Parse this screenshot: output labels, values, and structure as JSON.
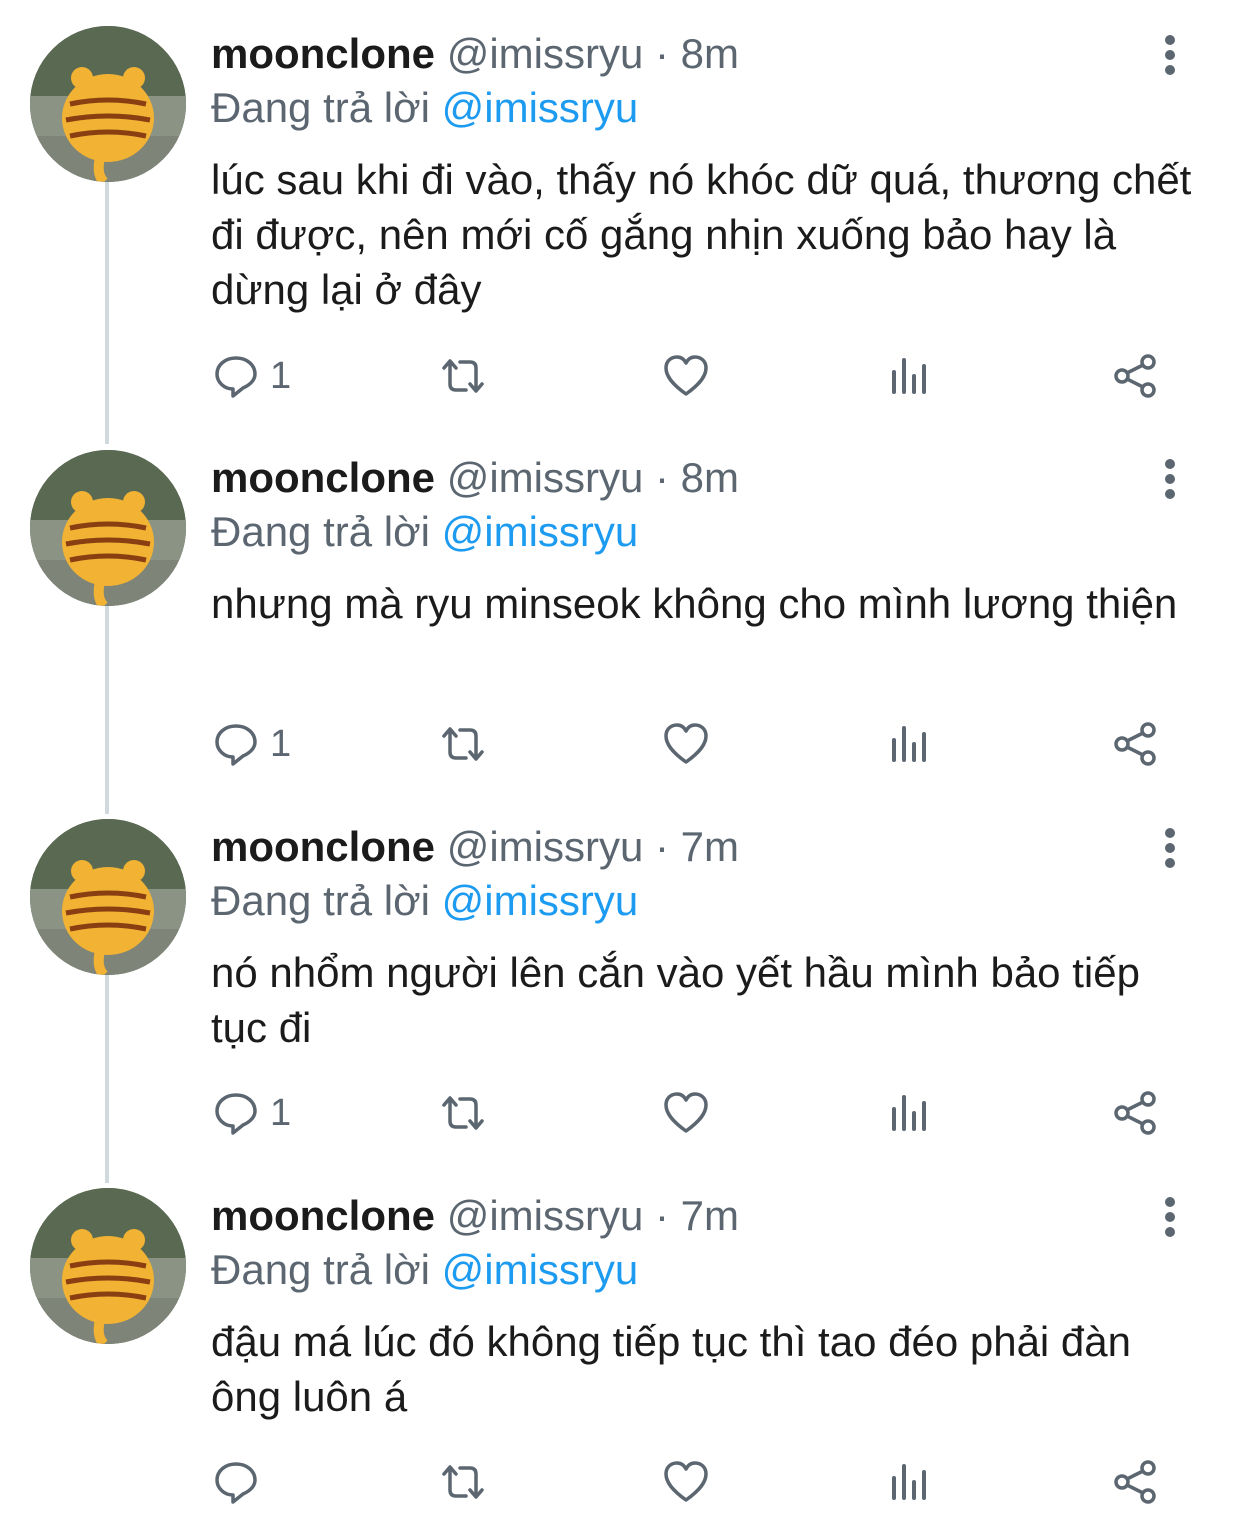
{
  "colors": {
    "text": "#1b1b1b",
    "secondary": "#5b6670",
    "accent": "#1d9bf0",
    "thread_line": "#cfd9de"
  },
  "icons": [
    "more-vertical-icon",
    "reply-icon",
    "retweet-icon",
    "like-icon",
    "views-icon",
    "share-icon"
  ],
  "tweets": [
    {
      "name": "moonclone",
      "handle": "@imissryu",
      "dot": "·",
      "time": "8m",
      "reply_prefix": "Đang trả lời",
      "reply_to": "@imissryu",
      "text": "lúc sau khi đi vào, thấy nó khóc dữ quá, thương chết đi được, nên mới cố gắng nhịn xuống bảo hay là dừng lại ở đây",
      "reply_count": "1"
    },
    {
      "name": "moonclone",
      "handle": "@imissryu",
      "dot": "·",
      "time": "8m",
      "reply_prefix": "Đang trả lời",
      "reply_to": "@imissryu",
      "text": "nhưng mà ryu minseok không cho mình lương thiện",
      "reply_count": "1"
    },
    {
      "name": "moonclone",
      "handle": "@imissryu",
      "dot": "·",
      "time": "7m",
      "reply_prefix": "Đang trả lời",
      "reply_to": "@imissryu",
      "text": "nó nhổm người lên cắn vào yết hầu mình bảo tiếp tục đi",
      "reply_count": "1"
    },
    {
      "name": "moonclone",
      "handle": "@imissryu",
      "dot": "·",
      "time": "7m",
      "reply_prefix": "Đang trả lời",
      "reply_to": "@imissryu",
      "text": "đậu má lúc đó không tiếp tục thì tao đéo phải đàn ông luôn á",
      "reply_count": ""
    }
  ]
}
